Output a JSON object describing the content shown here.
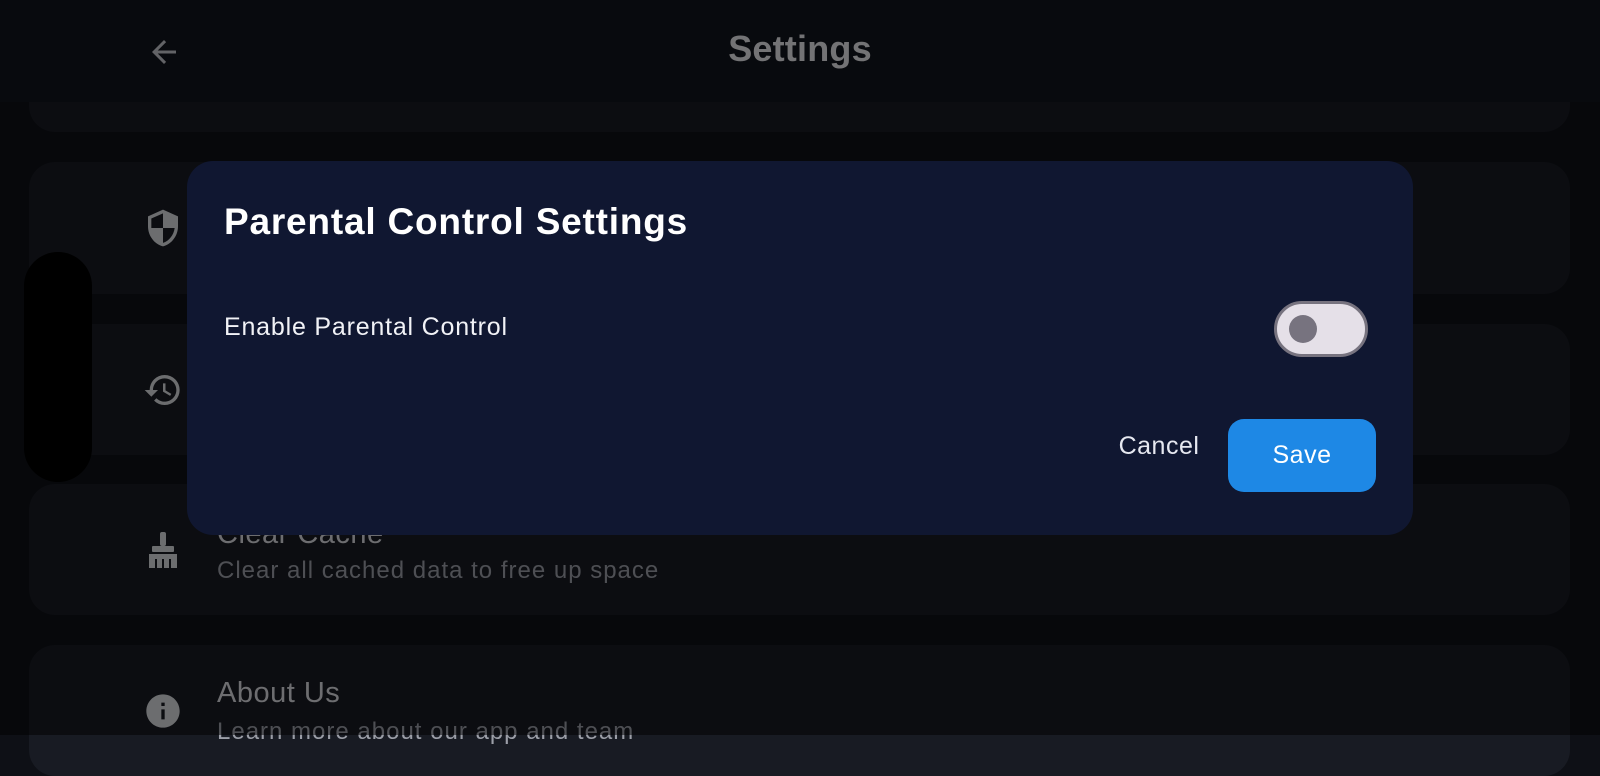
{
  "header": {
    "title": "Settings",
    "back_icon": "arrow-back-icon"
  },
  "settings_items": [
    {
      "id": "parental-control",
      "icon": "shield-icon"
    },
    {
      "id": "history",
      "icon": "history-icon"
    },
    {
      "id": "clear-cache",
      "icon": "broom-icon",
      "title": "Clear Cache",
      "subtitle": "Clear all cached data to free up space"
    },
    {
      "id": "about-us",
      "icon": "info-icon",
      "title": "About Us",
      "subtitle": "Learn more about our app and team"
    }
  ],
  "dialog": {
    "title": "Parental Control Settings",
    "toggle_label": "Enable Parental Control",
    "toggle_enabled": false,
    "cancel_label": "Cancel",
    "save_label": "Save"
  },
  "colors": {
    "background": "#0e1016",
    "card": "#181b23",
    "dialog": "#101731",
    "accent": "#1e88e5",
    "switch_track": "#e5e0e8",
    "switch_outline": "#77737f"
  }
}
